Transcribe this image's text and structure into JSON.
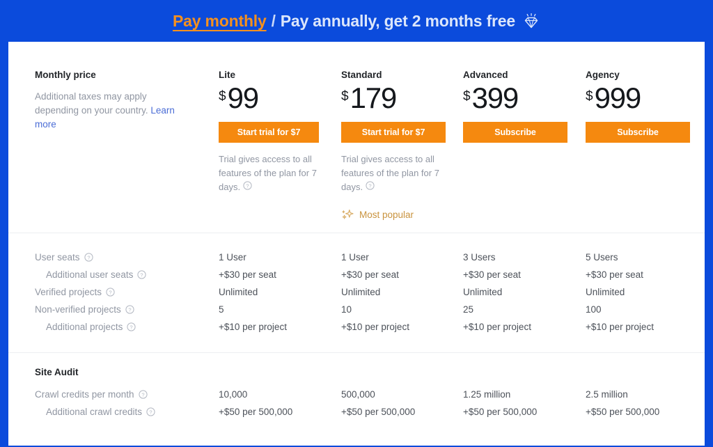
{
  "banner": {
    "monthly_label": "Pay monthly",
    "separator": "/",
    "annual_label": "Pay annually, get 2 months free",
    "diamond_icon": "diamond-icon",
    "bg_color": "#0b4bdc",
    "accent_color": "#f5901e"
  },
  "pricing": {
    "label_title": "Monthly price",
    "label_sub_part1": "Additional taxes may apply depending on your country. ",
    "label_link": "Learn more",
    "most_popular": "Most popular",
    "accent_orange": "#f5890f",
    "plans": [
      {
        "name": "Lite",
        "currency": "$",
        "amount": "99",
        "cta": "Start trial for $7",
        "note": "Trial gives access to all features of the plan for 7 days.",
        "has_note": true,
        "popular": false
      },
      {
        "name": "Standard",
        "currency": "$",
        "amount": "179",
        "cta": "Start trial for $7",
        "note": "Trial gives access to all features of the plan for 7 days.",
        "has_note": true,
        "popular": true
      },
      {
        "name": "Advanced",
        "currency": "$",
        "amount": "399",
        "cta": "Subscribe",
        "note": "",
        "has_note": false,
        "popular": false
      },
      {
        "name": "Agency",
        "currency": "$",
        "amount": "999",
        "cta": "Subscribe",
        "note": "",
        "has_note": false,
        "popular": false
      }
    ]
  },
  "features": {
    "rows": [
      {
        "label": "User seats",
        "indent": false,
        "info": true,
        "values": [
          "1 User",
          "1 User",
          "3 Users",
          "5 Users"
        ]
      },
      {
        "label": "Additional user seats",
        "indent": true,
        "info": true,
        "values": [
          "+$30 per seat",
          "+$30 per seat",
          "+$30 per seat",
          "+$30 per seat"
        ]
      },
      {
        "label": "Verified projects",
        "indent": false,
        "info": true,
        "values": [
          "Unlimited",
          "Unlimited",
          "Unlimited",
          "Unlimited"
        ]
      },
      {
        "label": "Non-verified projects",
        "indent": false,
        "info": true,
        "values": [
          "5",
          "10",
          "25",
          "100"
        ]
      },
      {
        "label": "Additional projects",
        "indent": true,
        "info": true,
        "values": [
          "+$10 per project",
          "+$10 per project",
          "+$10 per project",
          "+$10 per project"
        ]
      }
    ]
  },
  "site_audit": {
    "title": "Site Audit",
    "rows": [
      {
        "label": "Crawl credits per month",
        "indent": false,
        "info": true,
        "values": [
          "10,000",
          "500,000",
          "1.25 million",
          "2.5 million"
        ]
      },
      {
        "label": "Additional crawl credits",
        "indent": true,
        "info": true,
        "values": [
          "+$50 per 500,000",
          "+$50 per 500,000",
          "+$50 per 500,000",
          "+$50 per 500,000"
        ]
      }
    ]
  }
}
